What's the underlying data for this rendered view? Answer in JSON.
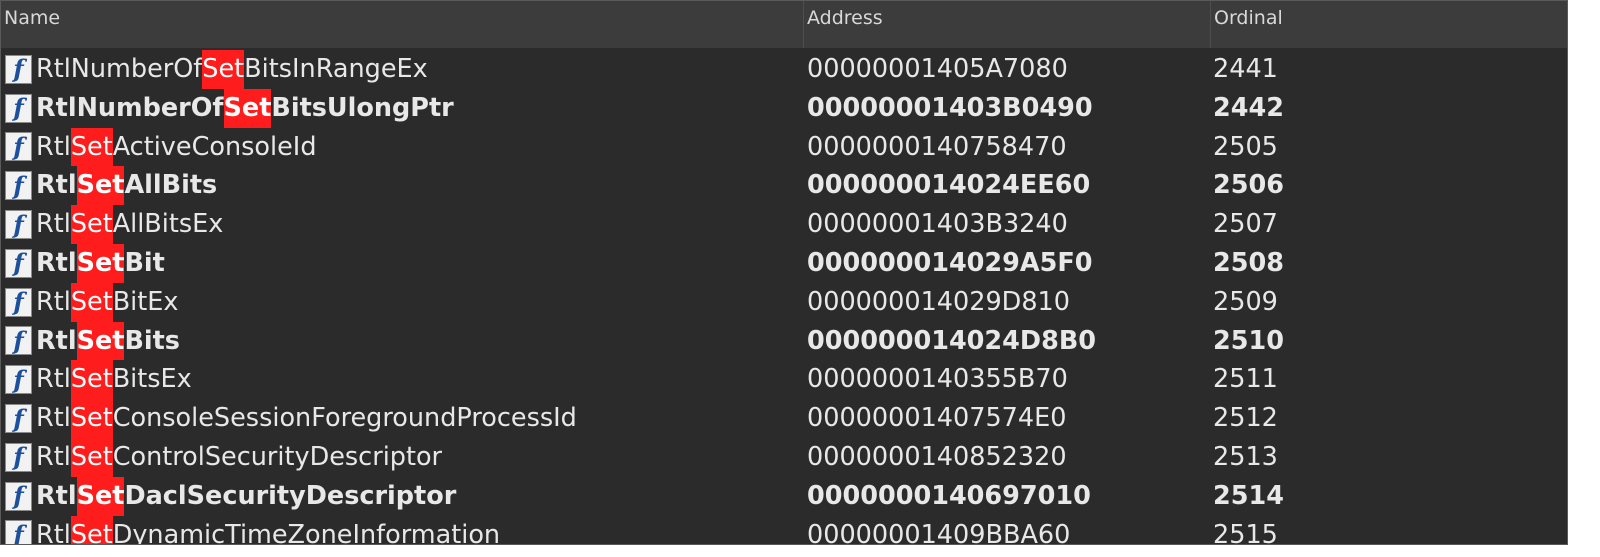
{
  "columns": {
    "name": "Name",
    "address": "Address",
    "ordinal": "Ordinal"
  },
  "highlight_color": "#ff1c1c",
  "icon": "function-icon",
  "rows": [
    {
      "prefix": "RtlNumberOf",
      "match": "Set",
      "suffix": "BitsInRangeEx",
      "address": "00000001405A7080",
      "ordinal": "2441",
      "bold": false
    },
    {
      "prefix": "RtlNumberOf",
      "match": "Set",
      "suffix": "BitsUlongPtr",
      "address": "00000001403B0490",
      "ordinal": "2442",
      "bold": true
    },
    {
      "prefix": "Rtl",
      "match": "Set",
      "suffix": "ActiveConsoleId",
      "address": "0000000140758470",
      "ordinal": "2505",
      "bold": false
    },
    {
      "prefix": "Rtl",
      "match": "Set",
      "suffix": "AllBits",
      "address": "000000014024EE60",
      "ordinal": "2506",
      "bold": true
    },
    {
      "prefix": "Rtl",
      "match": "Set",
      "suffix": "AllBitsEx",
      "address": "00000001403B3240",
      "ordinal": "2507",
      "bold": false
    },
    {
      "prefix": "Rtl",
      "match": "Set",
      "suffix": "Bit",
      "address": "000000014029A5F0",
      "ordinal": "2508",
      "bold": true
    },
    {
      "prefix": "Rtl",
      "match": "Set",
      "suffix": "BitEx",
      "address": "000000014029D810",
      "ordinal": "2509",
      "bold": false
    },
    {
      "prefix": "Rtl",
      "match": "Set",
      "suffix": "Bits",
      "address": "000000014024D8B0",
      "ordinal": "2510",
      "bold": true
    },
    {
      "prefix": "Rtl",
      "match": "Set",
      "suffix": "BitsEx",
      "address": "0000000140355B70",
      "ordinal": "2511",
      "bold": false
    },
    {
      "prefix": "Rtl",
      "match": "Set",
      "suffix": "ConsoleSessionForegroundProcessId",
      "address": "00000001407574E0",
      "ordinal": "2512",
      "bold": false
    },
    {
      "prefix": "Rtl",
      "match": "Set",
      "suffix": "ControlSecurityDescriptor",
      "address": "0000000140852320",
      "ordinal": "2513",
      "bold": false
    },
    {
      "prefix": "Rtl",
      "match": "Set",
      "suffix": "DaclSecurityDescriptor",
      "address": "0000000140697010",
      "ordinal": "2514",
      "bold": true
    },
    {
      "prefix": "Rtl",
      "match": "Set",
      "suffix": "DynamicTimeZoneInformation",
      "address": "00000001409BBA60",
      "ordinal": "2515",
      "bold": false
    }
  ]
}
